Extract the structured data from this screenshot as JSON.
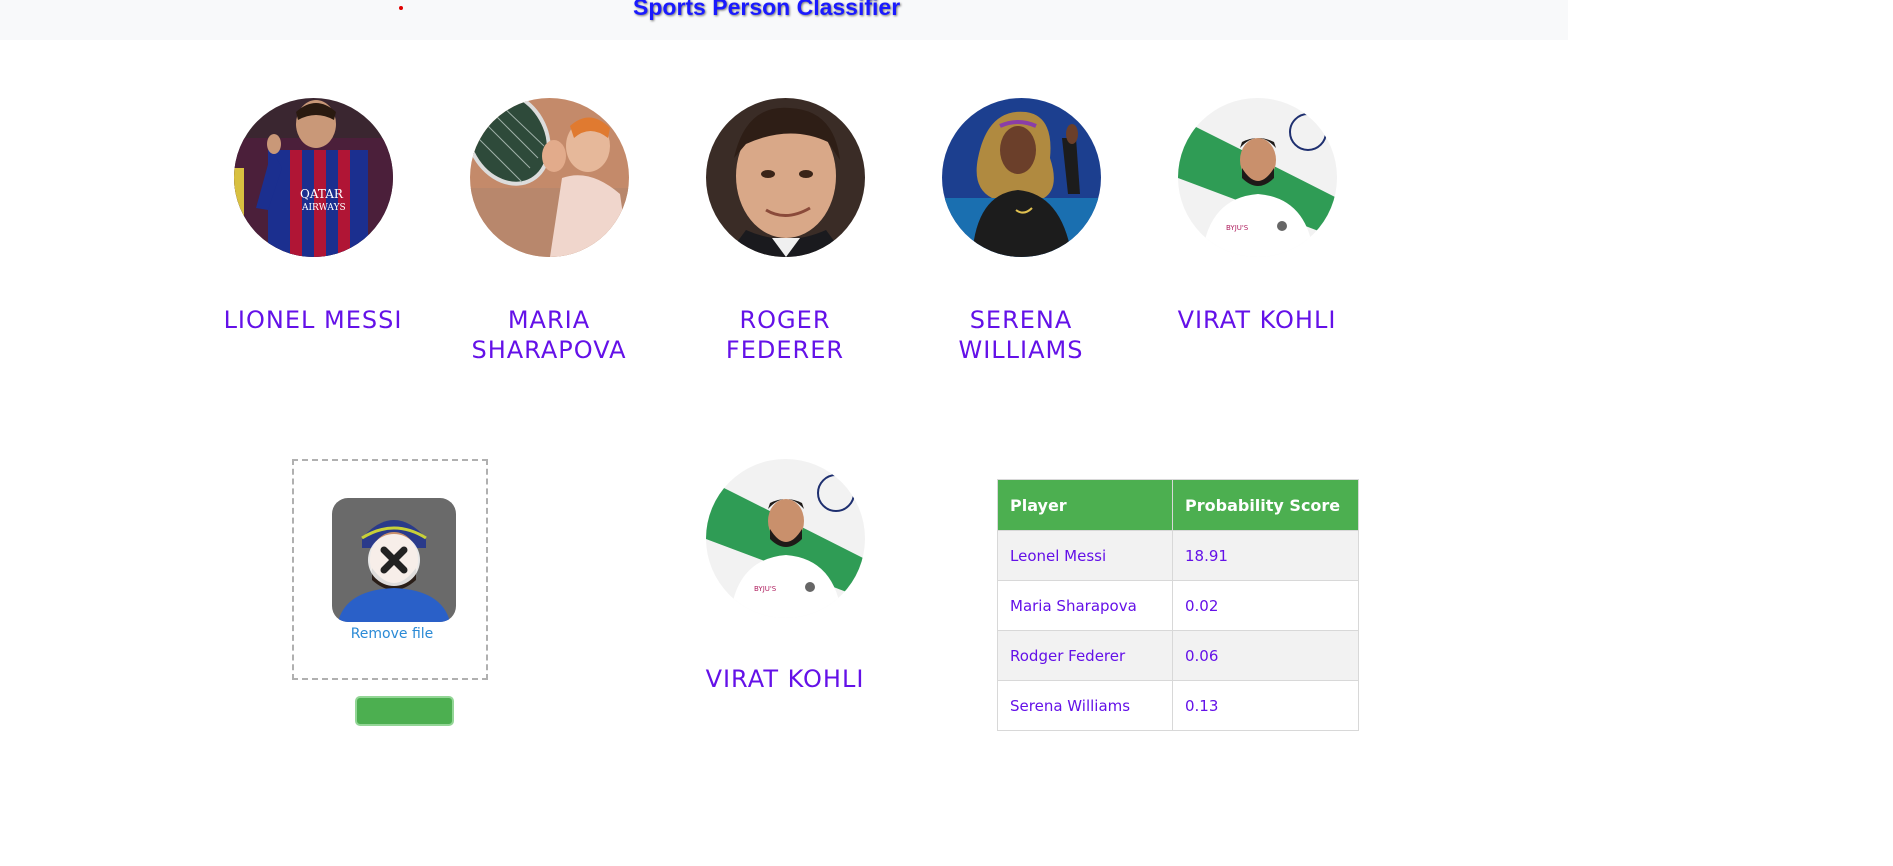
{
  "app": {
    "title": "Sports Person Classifier"
  },
  "players": [
    {
      "name": "LIONEL MESSI"
    },
    {
      "name": "MARIA SHARAPOVA"
    },
    {
      "name": "ROGER FEDERER"
    },
    {
      "name": "SERENA WILLIAMS"
    },
    {
      "name": "VIRAT KOHLI"
    }
  ],
  "upload": {
    "remove_label": "Remove file"
  },
  "result": {
    "name": "VIRAT KOHLI"
  },
  "table": {
    "headers": [
      "Player",
      "Probability Score"
    ],
    "rows": [
      {
        "player": "Leonel Messi",
        "score": "18.91"
      },
      {
        "player": "Maria Sharapova",
        "score": "0.02"
      },
      {
        "player": "Rodger Federer",
        "score": "0.06"
      },
      {
        "player": "Serena Williams",
        "score": "0.13"
      }
    ]
  },
  "colors": {
    "accent": "#6411e8",
    "title": "#1a1aff",
    "green": "#4caf50",
    "link": "#2a8ad6"
  }
}
